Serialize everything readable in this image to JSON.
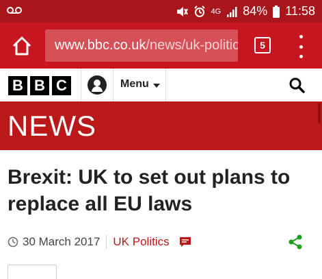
{
  "status_bar": {
    "battery": "84%",
    "time": "11:58",
    "network": "4G"
  },
  "browser": {
    "url_host": "www.bbc.co.uk",
    "url_path": "/news/uk-politic",
    "tab_count": "5"
  },
  "bbc_header": {
    "logo_letters": [
      "B",
      "B",
      "C"
    ],
    "menu_label": "Menu"
  },
  "banner": {
    "title": "NEWS",
    "color": "#bb1919"
  },
  "article": {
    "headline": "Brexit: UK to set out plans to replace all EU laws",
    "date": "30 March 2017",
    "category": "UK Politics",
    "category_color": "#bb1919",
    "share_color": "#1d9e1d"
  },
  "icons": {
    "status_left": "voicemail-icon",
    "status_right": [
      "mute-icon",
      "alarm-icon",
      "4g-icon",
      "signal-icon",
      "battery-icon"
    ],
    "toolbar": [
      "home-icon",
      "tabs-icon",
      "more-menu-icon"
    ],
    "header": [
      "account-icon",
      "search-icon"
    ],
    "meta": [
      "clock-icon",
      "comment-icon",
      "share-icon"
    ]
  }
}
